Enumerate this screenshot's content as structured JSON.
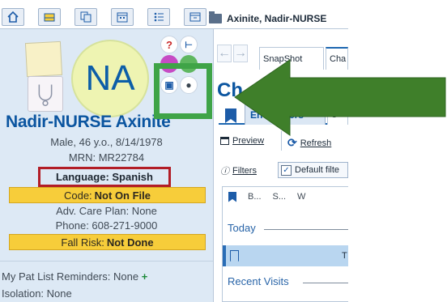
{
  "toolbar": {
    "buttons": [
      {
        "name": "home-icon"
      },
      {
        "name": "inbox-icon"
      },
      {
        "name": "copy-icon"
      },
      {
        "name": "calendar-icon"
      },
      {
        "name": "list-icon"
      },
      {
        "name": "window-icon"
      }
    ],
    "patient_tab": "Axinite, Nadir-NURSE"
  },
  "patient": {
    "initials": "NA",
    "name": "Nadir-NURSE Axinite",
    "demographics": "Male, 46 y.o., 8/14/1978",
    "mrn": "MRN: MR22784",
    "language": "Language: Spanish",
    "code_label": "Code:",
    "code_value": "Not On File",
    "adv_care_plan": "Adv. Care Plan: None",
    "phone": "Phone: 608-271-9000",
    "fall_risk_label": "Fall Risk:",
    "fall_risk_value": "Not Done",
    "reminders": "My Pat List Reminders: None",
    "reminders_add": "+",
    "isolation": "Isolation: None"
  },
  "header_icons": {
    "help": "?",
    "tree": "⊢",
    "video": "▣",
    "profile": "●"
  },
  "activity": {
    "tab_snapshot": "SnapShot",
    "tab_chart": "Cha",
    "heading": "Ch",
    "subtab_encounters": "Encounters",
    "subtab_next": "S",
    "preview": "Preview",
    "refresh": "Refresh",
    "filters": "Filters",
    "default_filter": "Default filte",
    "columns": [
      "B...",
      "S...",
      "W"
    ],
    "group_today": "Today",
    "group_recent": "Recent Visits",
    "selected_row_text": "T"
  },
  "annotation_colors": {
    "language_box": "#b21d26",
    "highlight_box": "#3fa447",
    "arrow": "#3f7f2a"
  }
}
